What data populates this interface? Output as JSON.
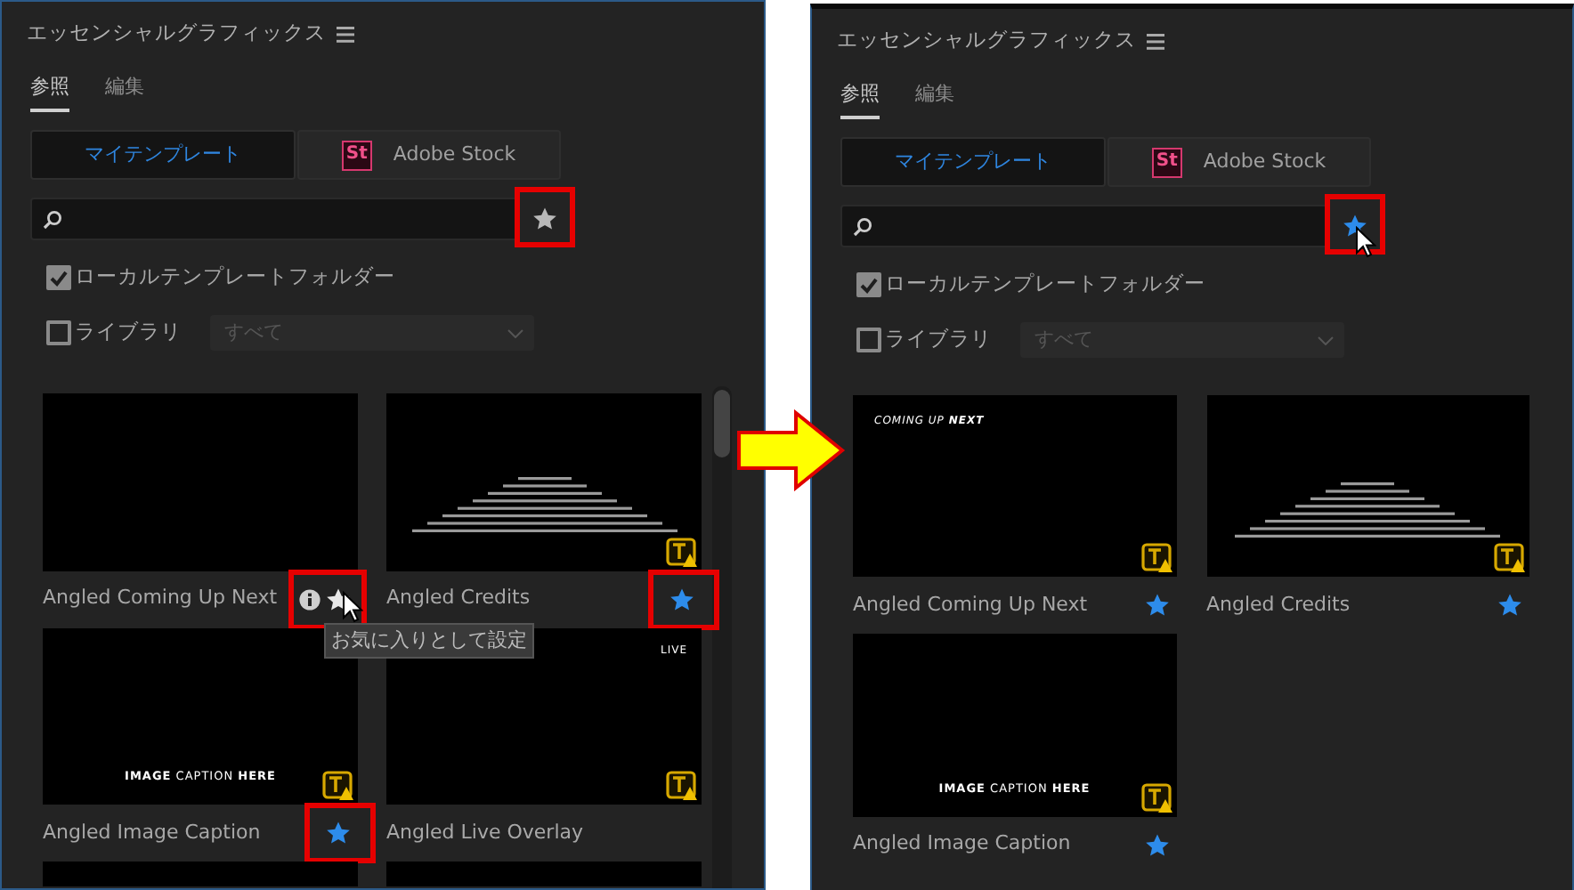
{
  "panels": [
    {
      "title": "エッセンシャルグラフィックス",
      "tabs": [
        {
          "label": "参照",
          "selected": true
        },
        {
          "label": "編集",
          "selected": false
        }
      ],
      "sources": [
        {
          "label": "マイテンプレート",
          "kind": "local",
          "selected": true
        },
        {
          "label": "Adobe Stock",
          "kind": "stock",
          "logo": "St",
          "selected": false
        }
      ],
      "favorites_filter": {
        "on": false,
        "highlighted": true,
        "hovered": false
      },
      "local_folder": {
        "label": "ローカルテンプレートフォルダー",
        "checked": true
      },
      "library": {
        "label": "ライブラリ",
        "checked": false,
        "value": "すべて",
        "disabled": true
      },
      "scrollable": true,
      "templates": [
        {
          "name": "Angled Coming Up Next",
          "kind": "blank",
          "favorite": false,
          "hovered": true,
          "highlighted": true,
          "font_warning": false,
          "tooltip": "お気に入りとして設定"
        },
        {
          "name": "Angled Credits",
          "kind": "credits",
          "favorite": true,
          "hovered": false,
          "highlighted": true,
          "font_warning": true
        },
        {
          "name": "Angled Image Caption",
          "kind": "caption",
          "caption": "**IMAGE** CAPTION **HERE**",
          "favorite": true,
          "hovered": false,
          "highlighted": true,
          "font_warning": true
        },
        {
          "name": "Angled Live Overlay",
          "kind": "live",
          "caption": "LIVE",
          "favorite": false,
          "hovered": false,
          "highlighted": false,
          "font_warning": true
        },
        {
          "kind": "blank",
          "favorite": false,
          "hovered": false,
          "highlighted": false,
          "font_warning": false
        },
        {
          "kind": "blank",
          "favorite": false,
          "hovered": false,
          "highlighted": false,
          "font_warning": false
        }
      ]
    },
    {
      "title": "エッセンシャルグラフィックス",
      "tabs": [
        {
          "label": "参照",
          "selected": true
        },
        {
          "label": "編集",
          "selected": false
        }
      ],
      "sources": [
        {
          "label": "マイテンプレート",
          "kind": "local",
          "selected": true
        },
        {
          "label": "Adobe Stock",
          "kind": "stock",
          "logo": "St",
          "selected": false
        }
      ],
      "favorites_filter": {
        "on": true,
        "highlighted": true,
        "hovered": true
      },
      "local_folder": {
        "label": "ローカルテンプレートフォルダー",
        "checked": true
      },
      "library": {
        "label": "ライブラリ",
        "checked": false,
        "value": "すべて",
        "disabled": true
      },
      "scrollable": false,
      "templates": [
        {
          "name": "Angled Coming Up Next",
          "kind": "coming",
          "caption": "COMING UP **NEXT**",
          "favorite": true,
          "hovered": false,
          "highlighted": false,
          "font_warning": true
        },
        {
          "name": "Angled Credits",
          "kind": "credits",
          "favorite": true,
          "hovered": false,
          "highlighted": false,
          "font_warning": true
        },
        {
          "name": "Angled Image Caption",
          "kind": "caption",
          "caption": "**IMAGE** CAPTION **HERE**",
          "favorite": true,
          "hovered": false,
          "highlighted": false,
          "font_warning": true
        }
      ]
    }
  ]
}
